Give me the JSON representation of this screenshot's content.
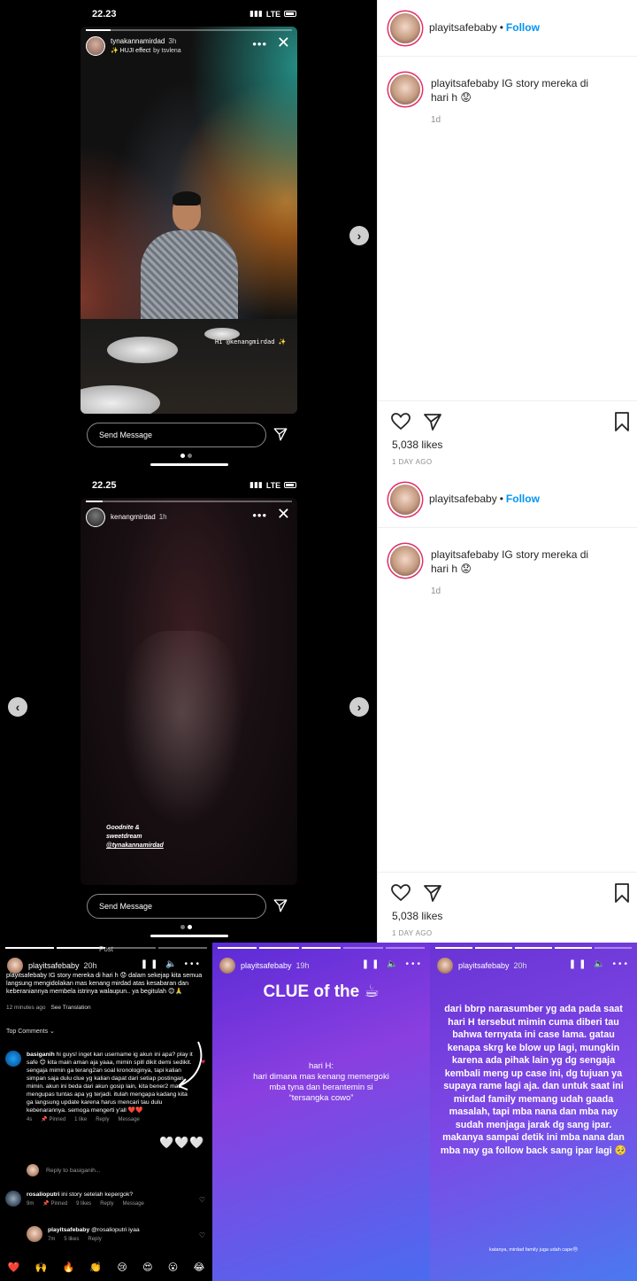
{
  "screens": [
    {
      "status": {
        "time": "22.23",
        "network": "LTE"
      },
      "story": {
        "username": "tynakannamirdad",
        "ago": "3h",
        "effect": "HUJI effect",
        "effect_by": "by tsvlena",
        "caption": "Hi @kenangmirdad ✨",
        "more": "•••",
        "close": "✕"
      },
      "nav": {
        "next": "›"
      },
      "send_message": "Send Message",
      "post": {
        "username": "playitsafebaby",
        "dot": "•",
        "follow": "Follow",
        "caption_user": "playitsafebaby",
        "caption_text": "IG story mereka di hari h 😟",
        "caption_age": "1d",
        "likes": "5,038 likes",
        "date": "1 DAY AGO"
      }
    },
    {
      "status": {
        "time": "22.25",
        "network": "LTE"
      },
      "story": {
        "username": "kenangmirdad",
        "ago": "1h",
        "caption_line1": "Goodnite &",
        "caption_line2": "sweetdream",
        "caption_tag": "@tynakannamirdad",
        "more": "•••",
        "close": "✕"
      },
      "nav": {
        "prev": "‹",
        "next": "›"
      },
      "send_message": "Send Message",
      "post": {
        "username": "playitsafebaby",
        "dot": "•",
        "follow": "Follow",
        "caption_user": "playitsafebaby",
        "caption_text": "IG story mereka di hari h 😟",
        "caption_age": "1d",
        "likes": "5,038 likes",
        "date": "1 DAY AGO"
      }
    }
  ],
  "bottom": {
    "left": {
      "top_label": "Post",
      "username": "playitsafebaby",
      "ago": "20h",
      "controls": "❚❚ 🔈 •••",
      "caption": "playitsafebaby IG story mereka di hari h 😟 dalam sekejap kita semua langsung mengidolakan mas kenang mirdad atas kesabaran dan keberaniannya membela istrinya walaupun.. ya begitulah 😊🙏",
      "meta_time": "12 minutes ago",
      "see_translation": "See Translation",
      "top_comments": "Top Comments ⌄",
      "comments": [
        {
          "username": "basiganih",
          "text": "hi guys! inget kan username ig akun ini apa? play it safe 😊 kita main aman aja yaaa, mimin spill dikit demi sedikit. sengaja mimin ga terang2an soal kronologinya, tapi kalian simpan saja dulu clue yg kalian dapat dari setiap postingan mimin. akun ini beda dari akun gosip lain, kita bener2 mau mengupas tuntas apa yg terjadi. itulah mengapa kadang kita ga langsung update karena harus mencari tau dulu kebenarannya. semoga mengerti y'all ❤️❤️",
          "time": "4s",
          "pinned": "📌 Pinned",
          "likes": "1 like",
          "reply": "Reply",
          "message": "Message"
        },
        {
          "username": "rosalioputri",
          "text": "ini story setelah kepergok?",
          "time": "9m",
          "pinned": "📌 Pinned",
          "likes": "9 likes",
          "reply": "Reply",
          "message": "Message"
        },
        {
          "username": "playitsafebaby",
          "text": "@rosalioputri iyaa",
          "time": "7m",
          "likes": "5 likes",
          "reply": "Reply"
        }
      ],
      "reply_to": "Reply to basiganih...",
      "hearts": "🤍🤍🤍",
      "emojis": [
        "❤️",
        "🙌",
        "🔥",
        "👏",
        "😢",
        "😍",
        "😮",
        "😂"
      ]
    },
    "middle": {
      "username": "playitsafebaby",
      "ago": "19h",
      "controls": "❚❚ 🔈 •••",
      "title": "CLUE of the ☕",
      "line1": "hari H:",
      "line2": "hari dimana mas kenang memergoki",
      "line3": "mba tyna dan berantemin si",
      "line4": "“tersangka cowo”"
    },
    "right": {
      "username": "playitsafebaby",
      "ago": "20h",
      "controls": "❚❚ 🔈 •••",
      "body": "dari bbrp narasumber yg ada pada saat hari H tersebut mimin cuma diberi tau bahwa ternyata ini case lama. gatau kenapa skrg ke blow up lagi, mungkin karena ada pihak lain yg dg sengaja kembali meng up case ini, dg tujuan ya supaya rame lagi aja. dan untuk saat ini mirdad family memang udah gaada masalah, tapi mba nana dan mba nay sudah menjaga jarak dg sang ipar. makanya sampai detik ini mba nana dan mba nay ga follow back sang ipar lagi 🥺",
      "footnote": "katanya, mirdad family juga udah cape😓"
    }
  }
}
